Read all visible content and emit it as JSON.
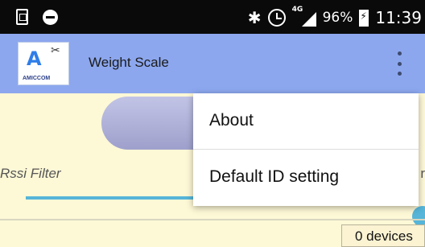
{
  "status_bar": {
    "icons_left": [
      "screenshot-icon",
      "do-not-disturb-icon"
    ],
    "icons_right": [
      "bluetooth-icon",
      "alarm-icon",
      "signal-icon",
      "battery-icon"
    ],
    "network": "4G",
    "battery": "96%",
    "time": "11:39"
  },
  "app_bar": {
    "logo_text": "AMICCOM",
    "title": "Weight Scale",
    "overflow_icon": "more-vert-icon",
    "color": "#8ca7ee"
  },
  "main": {
    "rssi_label": "Rssi Filter",
    "rssi_side_text": "r",
    "slider_color": "#56b5d8",
    "device_count": "0 devices"
  },
  "menu": {
    "items": [
      {
        "label": "About"
      },
      {
        "label": "Default ID setting"
      }
    ]
  },
  "colors": {
    "background": "#fdf8d6",
    "pill": "#9ea0cc"
  }
}
